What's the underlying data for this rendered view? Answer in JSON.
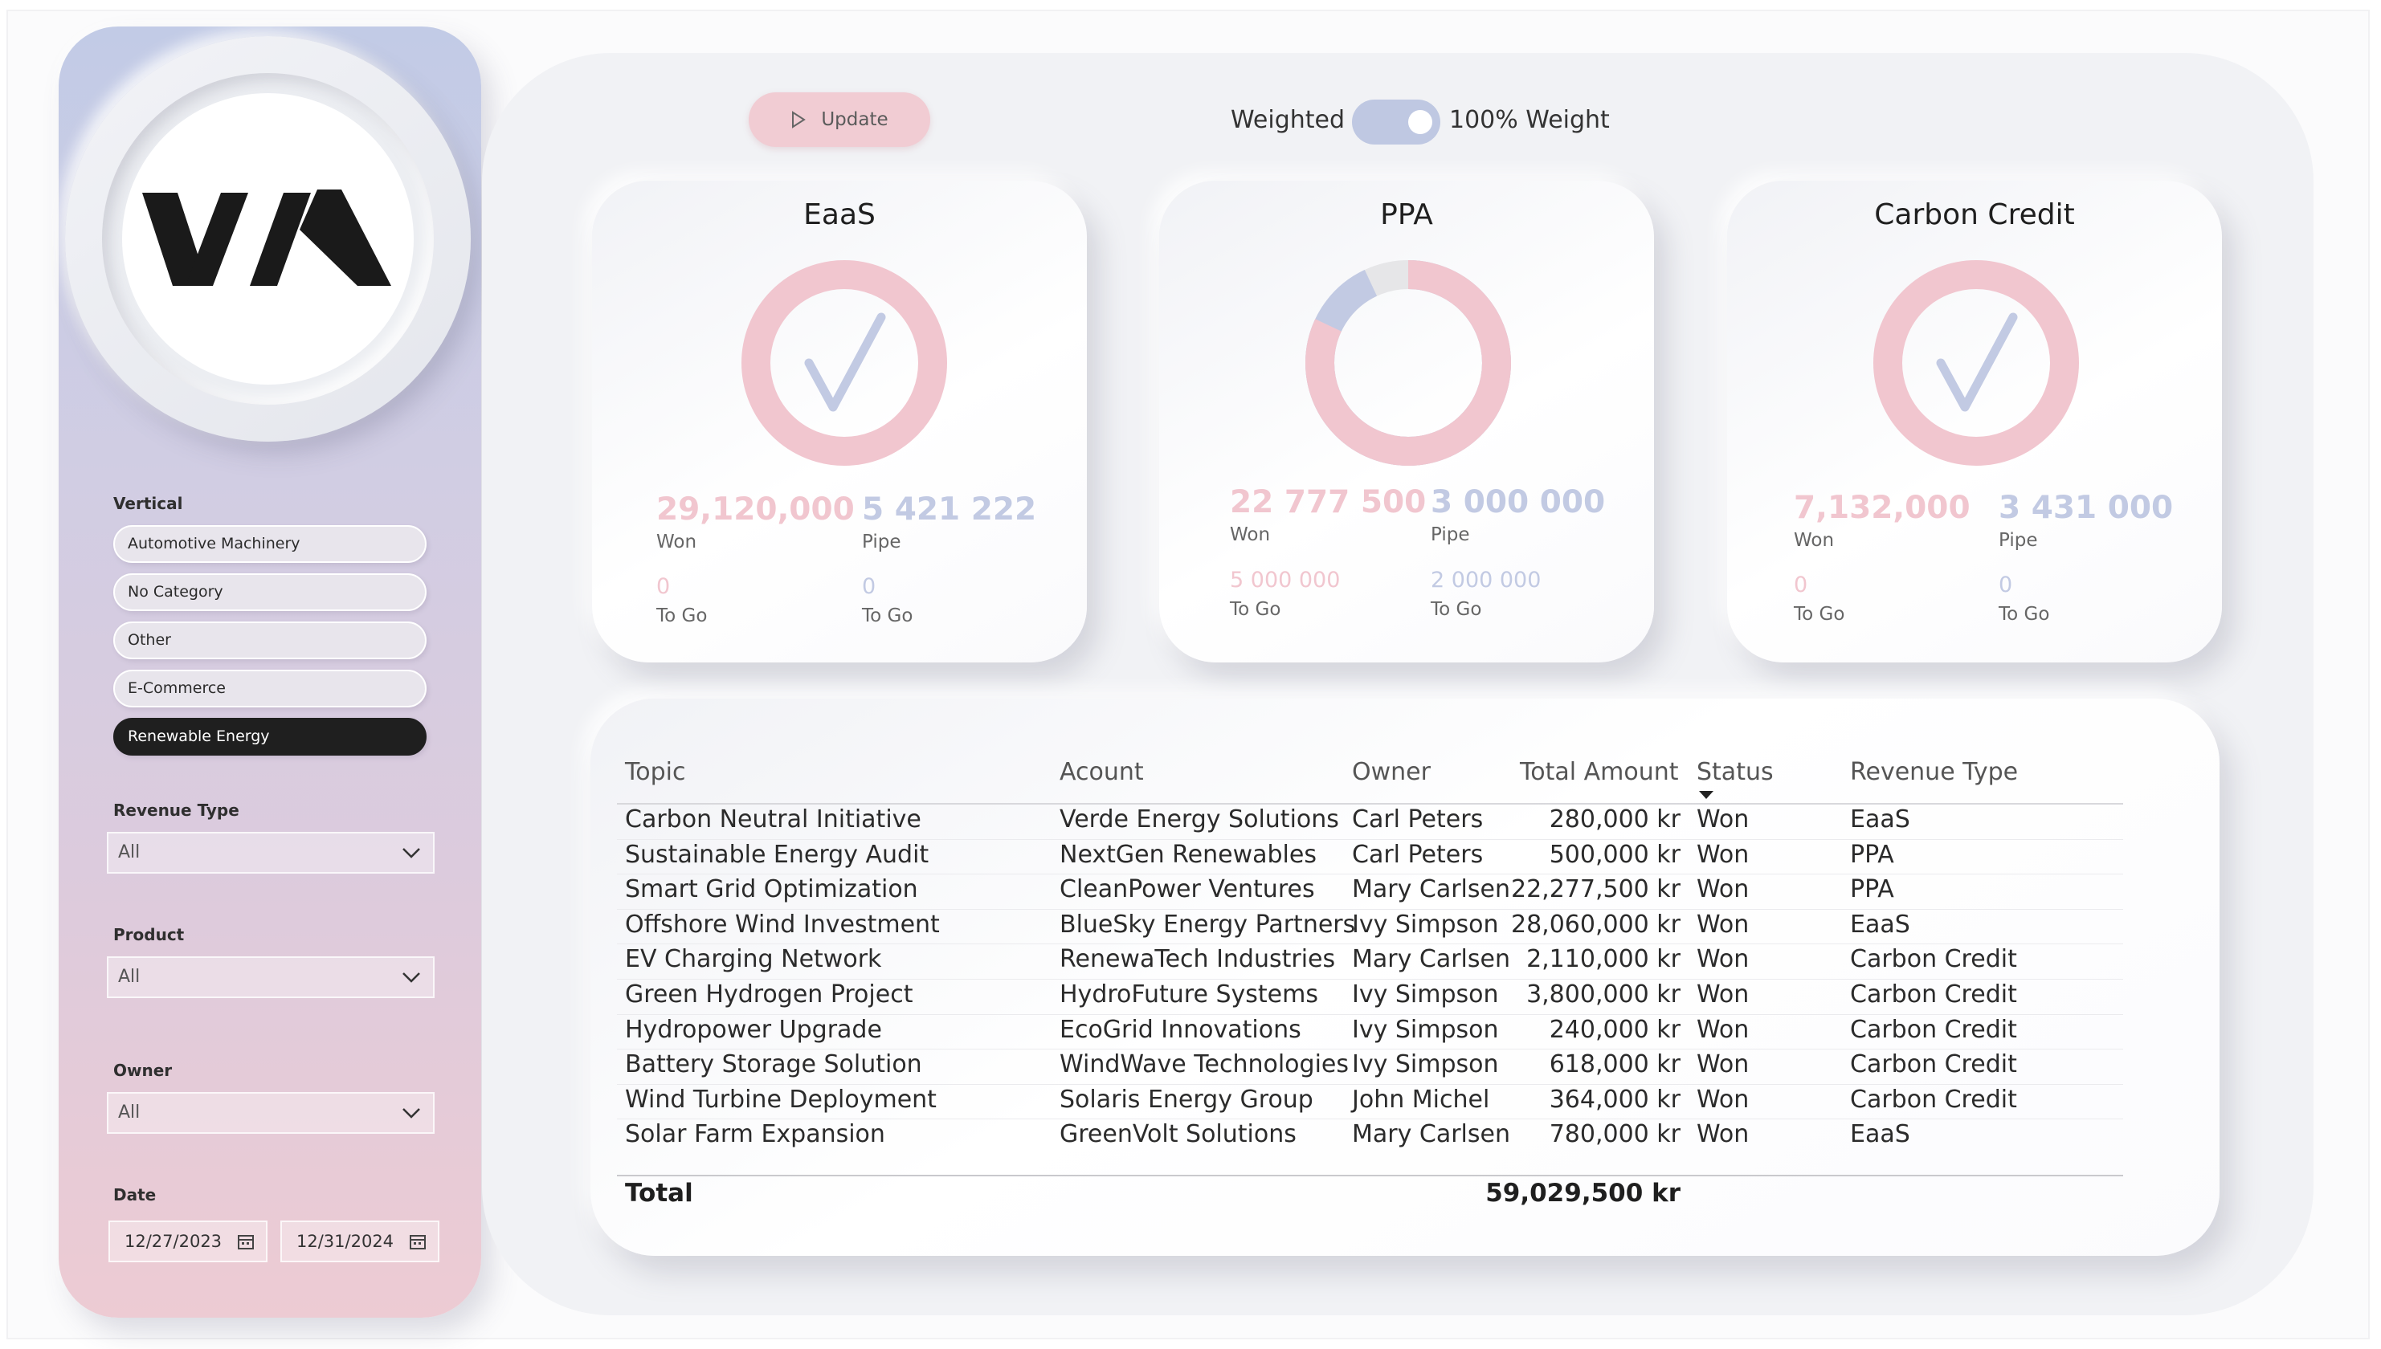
{
  "toolbar": {
    "update_label": "Update",
    "toggle_left_label": "Weighted",
    "toggle_right_label": "100% Weight",
    "toggle_on": true
  },
  "sidebar": {
    "vertical_label": "Vertical",
    "vertical_options": [
      {
        "label": "Automotive Machinery",
        "selected": false
      },
      {
        "label": "No Category",
        "selected": false
      },
      {
        "label": "Other",
        "selected": false
      },
      {
        "label": "E-Commerce",
        "selected": false
      },
      {
        "label": "Renewable Energy",
        "selected": true
      }
    ],
    "revenue_type_label": "Revenue Type",
    "revenue_type_value": "All",
    "product_label": "Product",
    "product_value": "All",
    "owner_label": "Owner",
    "owner_value": "All",
    "date_label": "Date",
    "date_start": "12/27/2023",
    "date_end": "12/31/2024"
  },
  "cards": [
    {
      "title": "EaaS",
      "won_value": "29,120,000",
      "won_label": "Won",
      "pipe_value": "5 421 222",
      "pipe_label": "Pipe",
      "won_togo_value": "0",
      "won_togo_label": "To Go",
      "pipe_togo_value": "0",
      "pipe_togo_label": "To Go",
      "complete": true,
      "progress_fraction": 1.0
    },
    {
      "title": "PPA",
      "won_value": "22 777 500",
      "won_label": "Won",
      "pipe_value": "3 000 000",
      "pipe_label": "Pipe",
      "won_togo_value": "5 000 000",
      "won_togo_label": "To Go",
      "pipe_togo_value": "2 000 000",
      "pipe_togo_label": "To Go",
      "complete": false,
      "progress_fraction": 0.82,
      "pipe_fraction": 0.11
    },
    {
      "title": "Carbon Credit",
      "won_value": "7,132,000",
      "won_label": "Won",
      "pipe_value": "3 431 000",
      "pipe_label": "Pipe",
      "won_togo_value": "0",
      "won_togo_label": "To Go",
      "pipe_togo_value": "0",
      "pipe_togo_label": "To Go",
      "complete": true,
      "progress_fraction": 1.0
    }
  ],
  "colors": {
    "pink": "#f1c6cf",
    "blue": "#c2cae3",
    "grey_ring": "#e6e6e8"
  },
  "table": {
    "headers": [
      "Topic",
      "Acount",
      "Owner",
      "Total Amount",
      "Status",
      "Revenue Type"
    ],
    "sorted_column": "Status",
    "rows": [
      [
        "Carbon Neutral Initiative",
        "Verde Energy Solutions",
        "Carl Peters",
        "280,000 kr",
        "Won",
        "EaaS"
      ],
      [
        "Sustainable Energy Audit",
        "NextGen Renewables",
        "Carl Peters",
        "500,000 kr",
        "Won",
        "PPA"
      ],
      [
        "Smart Grid Optimization",
        "CleanPower Ventures",
        "Mary Carlsen",
        "22,277,500 kr",
        "Won",
        "PPA"
      ],
      [
        "Offshore Wind Investment",
        "BlueSky Energy Partners",
        "Ivy Simpson",
        "28,060,000 kr",
        "Won",
        "EaaS"
      ],
      [
        "EV Charging Network",
        "RenewaTech Industries",
        "Mary Carlsen",
        "2,110,000 kr",
        "Won",
        "Carbon Credit"
      ],
      [
        "Green Hydrogen Project",
        "HydroFuture Systems",
        "Ivy Simpson",
        "3,800,000 kr",
        "Won",
        "Carbon Credit"
      ],
      [
        "Hydropower Upgrade",
        "EcoGrid Innovations",
        "Ivy Simpson",
        "240,000 kr",
        "Won",
        "Carbon Credit"
      ],
      [
        "Battery Storage Solution",
        "WindWave Technologies",
        "Ivy Simpson",
        "618,000 kr",
        "Won",
        "Carbon Credit"
      ],
      [
        "Wind Turbine Deployment",
        "Solaris Energy Group",
        "John Michel",
        "364,000 kr",
        "Won",
        "Carbon Credit"
      ],
      [
        "Solar Farm Expansion",
        "GreenVolt Solutions",
        "Mary Carlsen",
        "780,000 kr",
        "Won",
        "EaaS"
      ]
    ],
    "total_label": "Total",
    "total_amount": "59,029,500 kr"
  }
}
